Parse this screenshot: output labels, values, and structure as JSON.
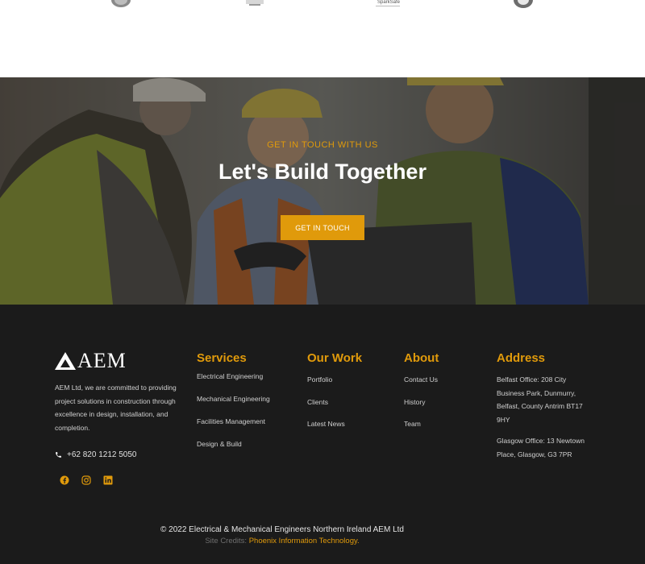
{
  "partners": {
    "logos": [
      {
        "name": "partner-logo-badge"
      },
      {
        "name": "partner-logo-emblem"
      },
      {
        "name": "partner-logo-sparksafe",
        "caption": "SparkSafe"
      },
      {
        "name": "partner-logo-round"
      }
    ]
  },
  "hero": {
    "eyebrow": "GET IN TOUCH WITH US",
    "title": "Let's Build Together",
    "button_label": "GET IN TOUCH"
  },
  "footer": {
    "brand": {
      "name": "AEM"
    },
    "about_text": "AEM Ltd, we are committed to providing project solutions in construction through excellence in design, installation, and completion.",
    "phone": "+62 820 1212 5050",
    "socials": [
      {
        "icon": "facebook-icon"
      },
      {
        "icon": "instagram-icon"
      },
      {
        "icon": "linkedin-icon"
      }
    ],
    "services": {
      "heading": "Services",
      "items": [
        "Electrical Engineering",
        "Mechanical Engineering",
        "Facilities Management",
        "Design & Build"
      ]
    },
    "work": {
      "heading": "Our Work",
      "items": [
        "Portfolio",
        "Clients",
        "Latest News"
      ]
    },
    "about": {
      "heading": "About",
      "items": [
        "Contact Us",
        "History",
        "Team"
      ]
    },
    "address": {
      "heading": "Address",
      "belfast": "Belfast Office: 208 City Business Park, Dunmurry, Belfast, County Antrim BT17 9HY",
      "glasgow": "Glasgow Office: 13 Newtown Place, Glasgow, G3 7PR"
    },
    "copyright": "© 2022 Electrical & Mechanical Engineers Northern Ireland AEM Ltd",
    "credits_prefix": "Site Credits:",
    "credits_link": "Phoenix Information Technology."
  },
  "colors": {
    "accent": "#e09a0b",
    "footer_bg": "#1b1b1b",
    "hero_overlay": "#141414"
  }
}
